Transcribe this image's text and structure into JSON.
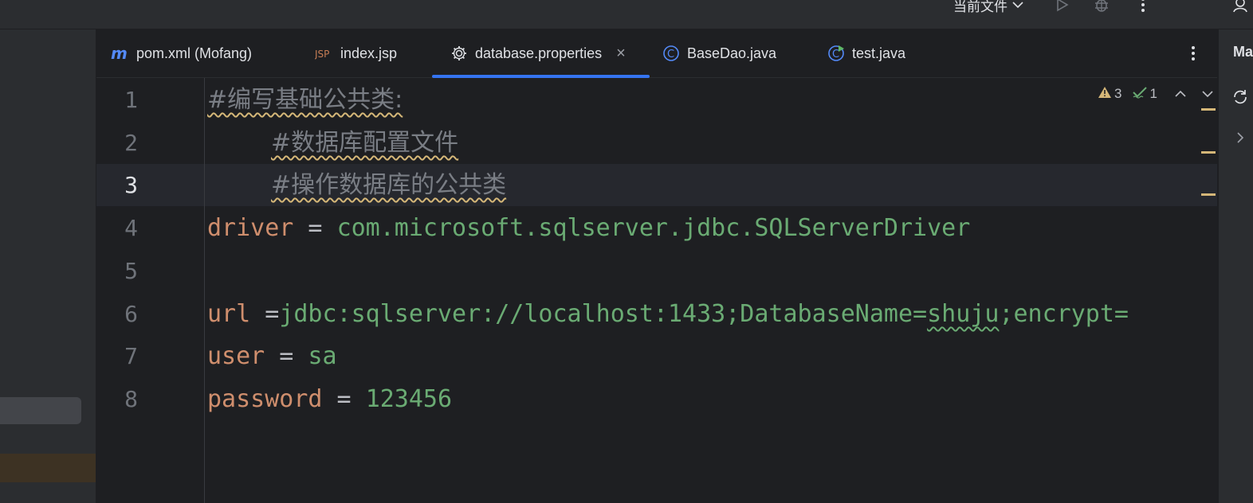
{
  "toolbar": {
    "run_config_label": "当前文件",
    "icons": [
      "chevron-down-icon",
      "run-icon",
      "debug-icon",
      "more-vertical-icon",
      "user-icon"
    ]
  },
  "tabs": [
    {
      "label": "pom.xml (Mofang)",
      "icon": "maven-icon"
    },
    {
      "label": "index.jsp",
      "icon": "jsp-icon"
    },
    {
      "label": "database.properties",
      "icon": "gear-icon",
      "active": true
    },
    {
      "label": "BaseDao.java",
      "icon": "class-icon"
    },
    {
      "label": "test.java",
      "icon": "runnable-class-icon"
    }
  ],
  "tab_close_glyph": "×",
  "inspections": {
    "warnings": "3",
    "weak_warnings": "1"
  },
  "editor": {
    "current_line": "3",
    "lines": [
      {
        "num": "1",
        "comment": "#编写基础公共类:"
      },
      {
        "num": "2",
        "comment": "#数据库配置文件"
      },
      {
        "num": "3",
        "comment": "#操作数据库的公共类"
      },
      {
        "num": "4",
        "key": "driver",
        "eq": " = ",
        "value": "com.microsoft.sqlserver.jdbc.SQLServerDriver"
      },
      {
        "num": "5"
      },
      {
        "num": "6",
        "key": "url",
        "eq": " =",
        "value_a": "jdbc:sqlserver://localhost:1433;DatabaseName=",
        "value_b": "shuju",
        "value_c": ";encrypt="
      },
      {
        "num": "7",
        "key": "user",
        "eq": " = ",
        "value": "sa"
      },
      {
        "num": "8",
        "key": "password",
        "eq": " = ",
        "value": "123456"
      }
    ]
  },
  "right_panel": {
    "title": "Ma"
  },
  "colors": {
    "accent": "#3574f0",
    "keyword": "#cf8e6d",
    "string": "#6aab73",
    "comment": "#7a7e85",
    "warning": "#d5b778"
  }
}
